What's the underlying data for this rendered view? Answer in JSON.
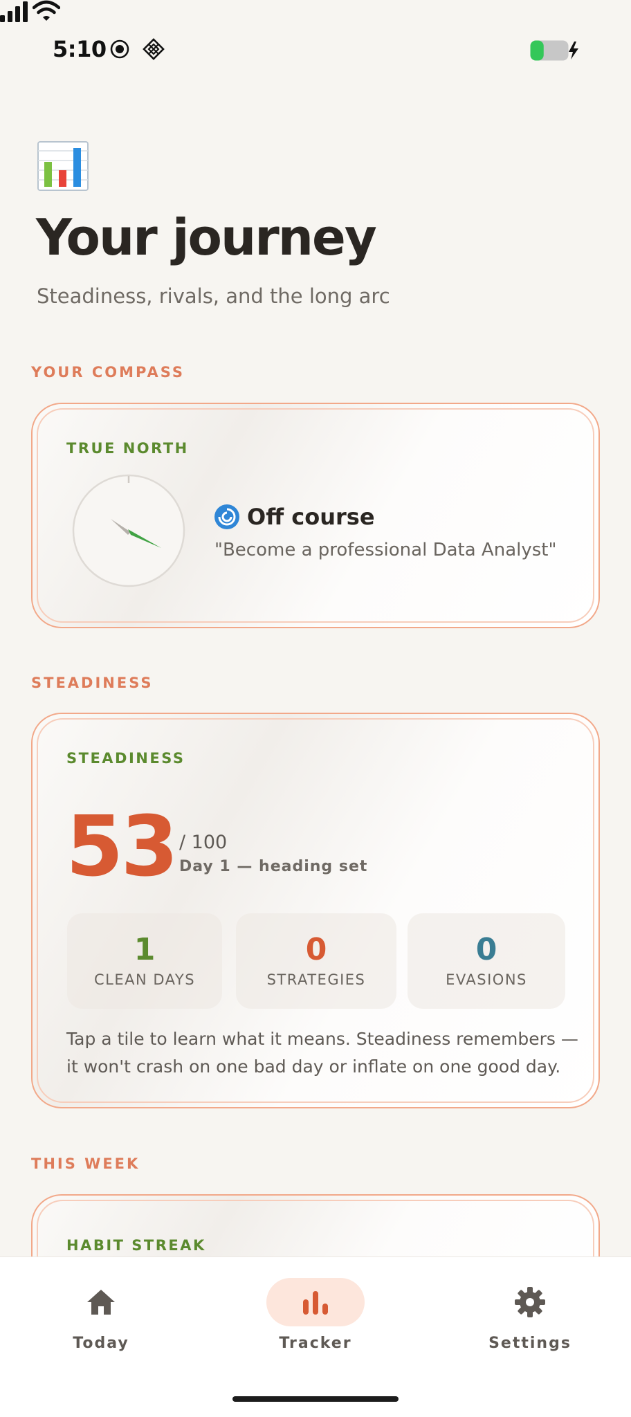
{
  "status_bar": {
    "time": "5:10",
    "battery_level": 0.35
  },
  "header": {
    "emoji_icon": "bar-chart-emoji-icon",
    "title": "Your journey",
    "subtitle": "Steadiness, rivals, and the long arc"
  },
  "compass": {
    "section_label": "YOUR COMPASS",
    "card_label": "TRUE NORTH",
    "status_icon": "cyclone-icon",
    "status": "Off course",
    "goal": "\"Become a professional Data Analyst\""
  },
  "steadiness": {
    "section_label": "STEADINESS",
    "card_label": "STEADINESS",
    "score": "53",
    "score_max": "/ 100",
    "day_label": "Day 1 — heading set",
    "tiles": [
      {
        "value": "1",
        "label": "CLEAN DAYS",
        "color": "#5b8a2e"
      },
      {
        "value": "0",
        "label": "STRATEGIES",
        "color": "#d75a33"
      },
      {
        "value": "0",
        "label": "EVASIONS",
        "color": "#3a7d93"
      }
    ],
    "note": "Tap a tile to learn what it means. Steadiness remembers — it won't crash on one bad day or inflate on one good day."
  },
  "this_week": {
    "section_label": "THIS WEEK",
    "card_label": "HABIT STREAK"
  },
  "nav": {
    "items": [
      {
        "label": "Today",
        "icon": "home-icon"
      },
      {
        "label": "Tracker",
        "icon": "tracker-bars-icon",
        "active": true
      },
      {
        "label": "Settings",
        "icon": "gear-icon"
      }
    ]
  },
  "colors": {
    "accent": "#d75a33",
    "green": "#5b8a2e",
    "teal": "#3a7d93",
    "section": "#de7c5a"
  }
}
